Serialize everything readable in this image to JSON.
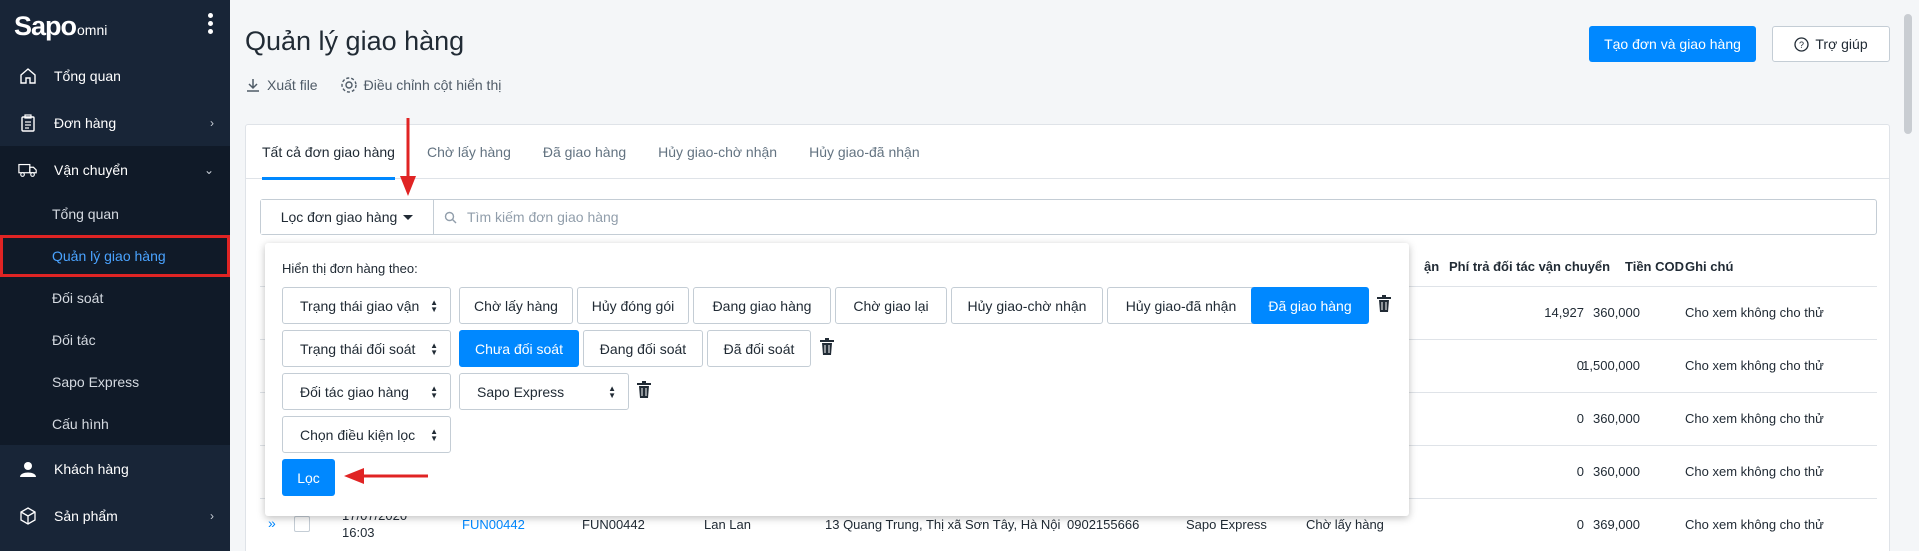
{
  "sidebar": {
    "logo": "Sapo",
    "logo_suffix": "omni",
    "items": [
      {
        "label": "Tổng quan"
      },
      {
        "label": "Đơn hàng"
      },
      {
        "label": "Vận chuyển"
      },
      {
        "label": "Khách hàng"
      },
      {
        "label": "Sản phẩm"
      }
    ],
    "sub_items": [
      {
        "label": "Tổng quan"
      },
      {
        "label": "Quản lý giao hàng"
      },
      {
        "label": "Đối soát"
      },
      {
        "label": "Đối tác"
      },
      {
        "label": "Sapo Express"
      },
      {
        "label": "Cấu hình"
      }
    ]
  },
  "header": {
    "title": "Quản lý giao hàng",
    "export_label": "Xuất file",
    "columns_label": "Điều chỉnh cột hiển thị",
    "create_label": "Tạo đơn và giao hàng",
    "help_label": "Trợ giúp"
  },
  "tabs": [
    {
      "label": "Tất cả đơn giao hàng"
    },
    {
      "label": "Chờ lấy hàng"
    },
    {
      "label": "Đã giao hàng"
    },
    {
      "label": "Hủy giao-chờ nhận"
    },
    {
      "label": "Hủy giao-đã nhận"
    }
  ],
  "filter": {
    "button_label": "Lọc đơn giao hàng",
    "search_placeholder": "Tìm kiếm đơn giao hàng"
  },
  "table": {
    "headers": {
      "partial": "ận",
      "fee": "Phí trả đối tác vận chuyển",
      "cod": "Tiền COD",
      "note": "Ghi chú"
    },
    "rows": [
      {
        "fee": "14,927",
        "cod": "360,000",
        "note": "Cho xem không cho thử"
      },
      {
        "fee": "0",
        "cod": "1,500,000",
        "note": "Cho xem không cho thử"
      },
      {
        "fee": "0",
        "cod": "360,000",
        "note": "Cho xem không cho thử"
      },
      {
        "fee": "0",
        "cod": "360,000",
        "note": "Cho xem không cho thử"
      }
    ],
    "last_row": {
      "date": "17/07/2020",
      "time": "16:03",
      "code": "FUN00442",
      "order": "FUN00442",
      "customer": "Lan Lan",
      "address": "13 Quang Trung, Thị xã Sơn Tây, Hà Nội",
      "phone": "0902155666",
      "partner": "Sapo Express",
      "status": "Chờ lấy hàng",
      "fee": "0",
      "cod": "369,000",
      "note": "Cho xem không cho thử"
    }
  },
  "panel": {
    "label": "Hiển thị đơn hàng theo:",
    "row1": {
      "select": "Trạng thái giao vận",
      "chips": [
        "Chờ lấy hàng",
        "Hủy đóng gói",
        "Đang giao hàng",
        "Chờ giao lại",
        "Hủy giao-chờ nhận",
        "Hủy giao-đã nhận",
        "Đã giao hàng"
      ]
    },
    "row2": {
      "select": "Trạng thái đối soát",
      "chips": [
        "Chưa đối soát",
        "Đang đối soát",
        "Đã đối soát"
      ]
    },
    "row3": {
      "select": "Đối tác giao hàng",
      "value": "Sapo Express"
    },
    "row4": {
      "select": "Chọn điều kiện lọc"
    },
    "submit_label": "Lọc"
  },
  "colors": {
    "accent": "#0088ff",
    "sidebar": "#182537",
    "highlight": "#e02424"
  }
}
